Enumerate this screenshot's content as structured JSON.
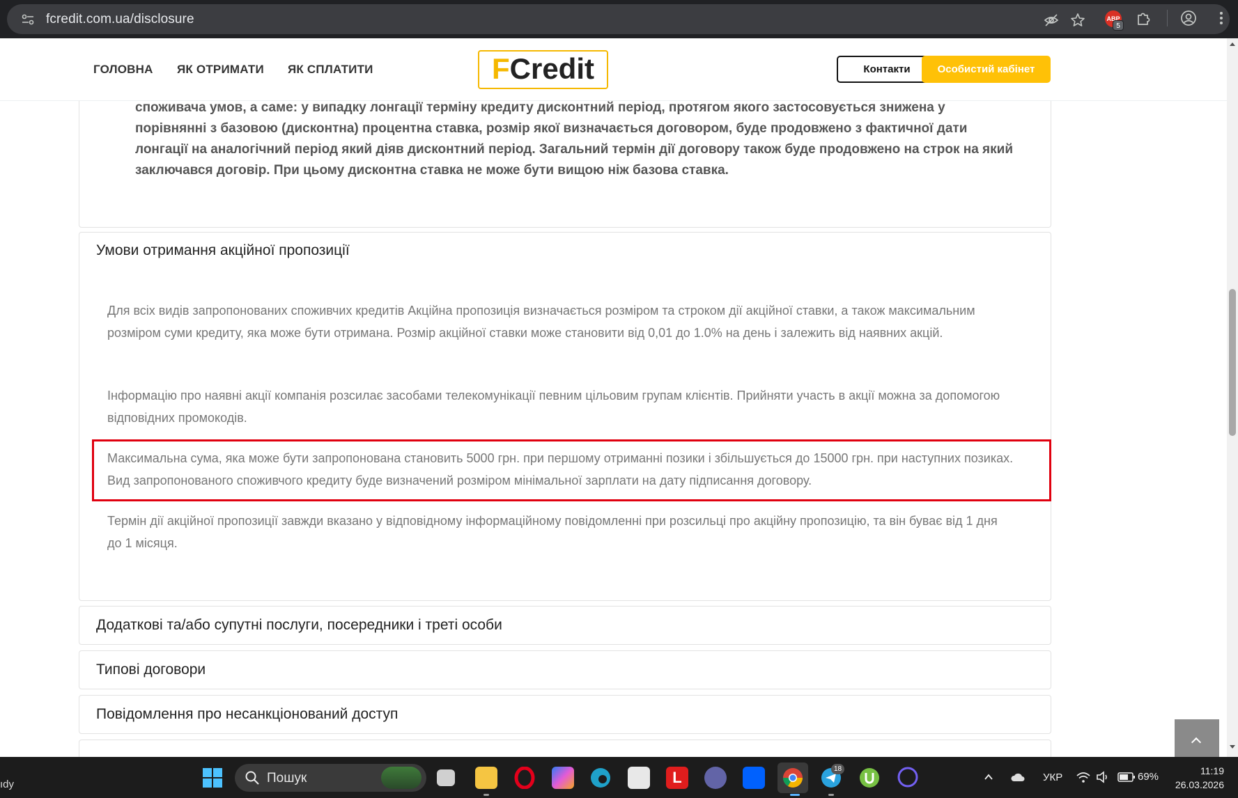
{
  "browser": {
    "url": "fcredit.com.ua/disclosure",
    "extension_badge_text": "ABP",
    "extension_count": "5"
  },
  "header": {
    "nav": [
      "ГОЛОВНА",
      "ЯК ОТРИМАТИ",
      "ЯК СПЛАТИТИ"
    ],
    "logo_f": "F",
    "logo_rest": "Credit",
    "contacts_label": "Контакти",
    "cabinet_label": "Особистий кабінет"
  },
  "content": {
    "top_bold_paragraph": "споживача умов, а саме: у випадку лонгації терміну кредиту дисконтний період, протягом якого застосовується знижена у порівнянні з базовою (дисконтна) процентна ставка, розмір якої визначається договором, буде продовжено з фактичної дати лонгації на аналогічний період який діяв дисконтний період. Загальний термін дії договору також буде продовжено на строк на який заключався договір. При цьому дисконтна ставка не може бути вищою ніж базова ставка.",
    "section_title": "Умови отримання акційної пропозиції",
    "paragraphs": [
      "Для всіх видів запропонованих споживчих кредитів Акційна пропозиція визначається розміром та строком дії акційної ставки, а також максимальним розміром суми кредиту, яка може бути отримана. Розмір акційної ставки може становити від 0,01 до 1.0% на день і залежить від наявних акцій.",
      "Інформацію про наявні акції компанія розсилає засобами телекомунікації певним цільовим групам клієнтів. Прийняти участь в акції можна за допомогою відповідних промокодів.",
      "Максимальна сума, яка може бути запропонована становить 5000 грн. при першому отриманні позики і збільшується до 15000 грн. при наступних позиках. Вид запропонованого споживчого кредиту буде визначений розміром мінімальної зарплати на дату підписання договору.",
      "Термін дії акційної пропозиції завжди вказано у відповідному інформаційному повідомленні при розсильці про акційну пропозицію, та він буває від 1 дня до 1 місяця."
    ],
    "accordion": [
      "Додаткові та/або супутні послуги, посередники і треті особи",
      "Типові договори",
      "Повідомлення про несанкціонований доступ"
    ]
  },
  "taskbar": {
    "left_text": "ıdy",
    "search_placeholder": "Пошук",
    "telegram_badge": "18",
    "language": "УКР",
    "battery": "69%",
    "time": "11:19",
    "date": "26.03.2026"
  },
  "colors": {
    "brand_yellow": "#ffc107",
    "highlight_red": "#e0000f"
  }
}
